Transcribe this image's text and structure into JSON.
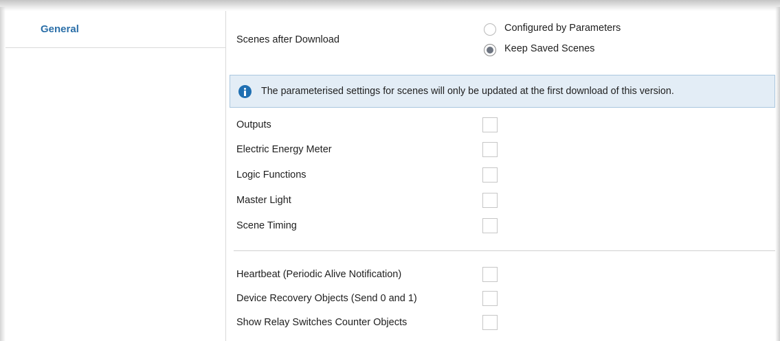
{
  "sidebar": {
    "items": [
      {
        "label": "General"
      }
    ]
  },
  "scenes": {
    "label": "Scenes after Download",
    "options": [
      {
        "label": "Configured by Parameters",
        "selected": false
      },
      {
        "label": "Keep Saved Scenes",
        "selected": true
      }
    ]
  },
  "info": {
    "text": "The parameterised settings for scenes will only be updated at the first download of this version."
  },
  "modules": [
    {
      "label": "Outputs",
      "checked": false
    },
    {
      "label": "Electric Energy Meter",
      "checked": false
    },
    {
      "label": "Logic Functions",
      "checked": false
    },
    {
      "label": "Master Light",
      "checked": false
    },
    {
      "label": "Scene Timing",
      "checked": false
    }
  ],
  "objects": [
    {
      "label": "Heartbeat (Periodic Alive Notification)",
      "checked": false
    },
    {
      "label": "Device Recovery Objects (Send 0 and 1)",
      "checked": false
    },
    {
      "label": "Show Relay Switches Counter Objects",
      "checked": false
    }
  ],
  "colors": {
    "accent": "#2b6fa8",
    "info_bg": "#e3edf6",
    "info_border": "#a9c6de",
    "info_icon": "#1f6fb2"
  }
}
